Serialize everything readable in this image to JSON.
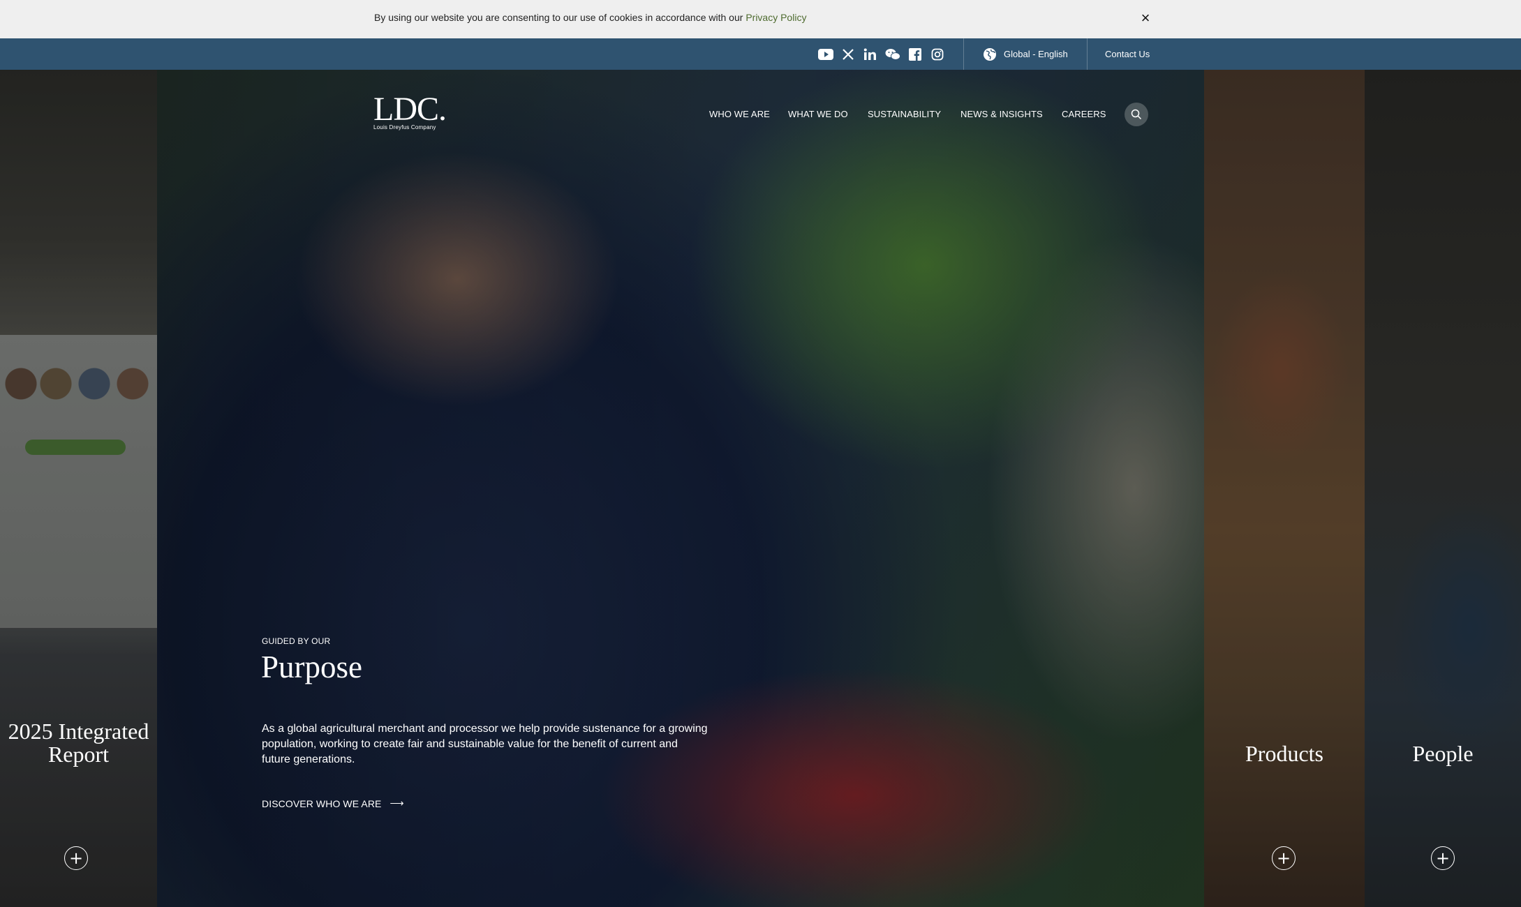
{
  "cookie_banner": {
    "text": "By using our website you are consenting to our use of cookies in accordance with our",
    "link_label": "Privacy Policy",
    "close_glyph": "×"
  },
  "utility_bar": {
    "social_icons": [
      "youtube-icon",
      "x-icon",
      "linkedin-icon",
      "wechat-icon",
      "facebook-icon",
      "instagram-icon"
    ],
    "language_label": "Global - English",
    "contact_label": "Contact Us"
  },
  "header": {
    "logo_text": "LDC.",
    "logo_subtext": "Louis Dreyfus Company",
    "nav": [
      "WHO WE ARE",
      "WHAT WE DO",
      "SUSTAINABILITY",
      "NEWS & INSIGHTS",
      "CAREERS"
    ]
  },
  "hero": {
    "eyebrow": "GUIDED BY OUR",
    "title": "Purpose",
    "description": "As a global agricultural merchant and processor we help provide sustenance for a growing population, working to create fair and sustainable value for the benefit of current and future generations.",
    "cta_label": "DISCOVER WHO WE ARE",
    "cta_arrow": "⟶"
  },
  "side_panels": [
    {
      "title_line1": "2025 Integrated",
      "title_line2": "Report",
      "button": "+"
    },
    {
      "title": "Products",
      "button": "+"
    },
    {
      "title": "People",
      "button": "+"
    }
  ],
  "colors": {
    "utility_bar": "#2f5370",
    "cookie_bar": "#efefef",
    "privacy_link": "#4e6b2f"
  }
}
